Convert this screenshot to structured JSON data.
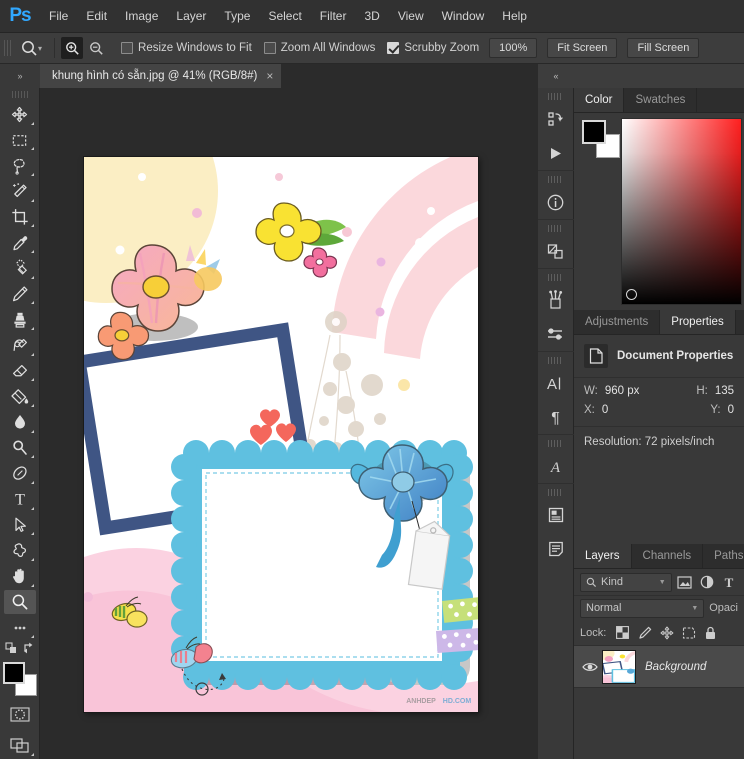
{
  "app": {
    "name": "Ps",
    "menus": [
      "File",
      "Edit",
      "Image",
      "Layer",
      "Type",
      "Select",
      "Filter",
      "3D",
      "View",
      "Window",
      "Help"
    ]
  },
  "options_bar": {
    "tool_icon": "zoom-icon",
    "zoom_in_label": "zoom-in-icon",
    "zoom_out_label": "zoom-out-icon",
    "checkboxes": [
      {
        "label": "Resize Windows to Fit",
        "checked": false
      },
      {
        "label": "Zoom All Windows",
        "checked": false
      },
      {
        "label": "Scrubby Zoom",
        "checked": true
      }
    ],
    "buttons": [
      "100%",
      "Fit Screen",
      "Fill Screen"
    ]
  },
  "document": {
    "tab_title": "khung hình có sẵn.jpg @ 41% (RGB/8#)",
    "close_glyph": "×",
    "zoom_level": "41%",
    "color_mode": "RGB/8#"
  },
  "toolbar": {
    "collapse_glyph": "»",
    "tools": [
      {
        "name": "move-tool",
        "icon": "move-icon",
        "has_flyout": true
      },
      {
        "name": "rectangular-marquee-tool",
        "icon": "marquee-icon",
        "has_flyout": true
      },
      {
        "name": "lasso-tool",
        "icon": "lasso-icon",
        "has_flyout": true
      },
      {
        "name": "quick-selection-tool",
        "icon": "magic-wand-icon",
        "has_flyout": true
      },
      {
        "name": "crop-tool",
        "icon": "crop-icon",
        "has_flyout": true
      },
      {
        "name": "eyedropper-tool",
        "icon": "eyedropper-icon",
        "has_flyout": true
      },
      {
        "name": "spot-healing-brush-tool",
        "icon": "healing-brush-icon",
        "has_flyout": true
      },
      {
        "name": "brush-tool",
        "icon": "brush-icon",
        "has_flyout": true
      },
      {
        "name": "clone-stamp-tool",
        "icon": "clone-stamp-icon",
        "has_flyout": true
      },
      {
        "name": "history-brush-tool",
        "icon": "history-brush-icon",
        "has_flyout": true
      },
      {
        "name": "eraser-tool",
        "icon": "eraser-icon",
        "has_flyout": true
      },
      {
        "name": "gradient-tool",
        "icon": "paint-bucket-icon",
        "has_flyout": true
      },
      {
        "name": "blur-tool",
        "icon": "blur-drop-icon",
        "has_flyout": true
      },
      {
        "name": "dodge-tool",
        "icon": "dodge-icon",
        "has_flyout": true
      },
      {
        "name": "pen-tool",
        "icon": "pen-icon",
        "has_flyout": true
      },
      {
        "name": "type-tool",
        "icon": "type-t-icon",
        "has_flyout": true
      },
      {
        "name": "path-selection-tool",
        "icon": "path-arrow-icon",
        "has_flyout": true
      },
      {
        "name": "custom-shape-tool",
        "icon": "shape-star-icon",
        "has_flyout": true
      },
      {
        "name": "hand-tool",
        "icon": "hand-icon",
        "has_flyout": true
      },
      {
        "name": "zoom-tool",
        "icon": "magnifier-icon",
        "has_flyout": false,
        "active": true
      },
      {
        "name": "edit-toolbar-tool",
        "icon": "ellipsis-icon",
        "has_flyout": true
      }
    ],
    "foreground_color": "#000000",
    "background_color": "#ffffff",
    "quick_mask_icon": "quick-mask-icon",
    "screen_mode_icon": "screen-mode-icon"
  },
  "dock_rail": {
    "collapse_glyph": "«",
    "icons": [
      {
        "name": "history-panel-icon"
      },
      {
        "name": "actions-panel-icon"
      },
      {
        "name": "info-panel-icon"
      },
      {
        "name": "layer-comps-panel-icon"
      },
      {
        "name": "brushes-panel-icon"
      },
      {
        "name": "brush-settings-panel-icon"
      },
      {
        "name": "character-panel-icon"
      },
      {
        "name": "paragraph-panel-icon"
      },
      {
        "name": "glyphs-panel-icon"
      },
      {
        "name": "libraries-panel-icon"
      },
      {
        "name": "notes-panel-icon"
      }
    ]
  },
  "color_panel": {
    "tabs": [
      {
        "label": "Color",
        "selected": true
      },
      {
        "label": "Swatches",
        "selected": false
      }
    ],
    "foreground_color": "#000000",
    "background_color": "#ffffff",
    "ramp_hue": "#ff1f1f"
  },
  "properties_panel": {
    "tabs": [
      {
        "label": "Adjustments",
        "selected": false
      },
      {
        "label": "Properties",
        "selected": true
      }
    ],
    "header": "Document Properties",
    "header_icon": "document-icon",
    "fields": [
      {
        "key": "W:",
        "value": "960 px"
      },
      {
        "key": "H:",
        "value": "135"
      },
      {
        "key": "X:",
        "value": "0"
      },
      {
        "key": "Y:",
        "value": "0"
      }
    ],
    "resolution": "Resolution: 72 pixels/inch"
  },
  "layers_panel": {
    "tabs": [
      {
        "label": "Layers",
        "selected": true
      },
      {
        "label": "Channels",
        "selected": false
      },
      {
        "label": "Paths",
        "selected": false
      }
    ],
    "filter_value": "Kind",
    "filter_icon": "search-icon",
    "filter_types": [
      "pixel-filter-icon",
      "adjustment-filter-icon",
      "type-filter-icon"
    ],
    "blend_mode": "Normal",
    "opacity_label": "Opaci",
    "lock_label": "Lock:",
    "lock_icons": [
      "lock-transparency-icon",
      "lock-image-icon",
      "lock-position-icon",
      "lock-artboard-icon",
      "lock-all-icon"
    ],
    "layers": [
      {
        "name": "Background",
        "visible": true,
        "visibility_icon": "eye-icon"
      }
    ]
  }
}
